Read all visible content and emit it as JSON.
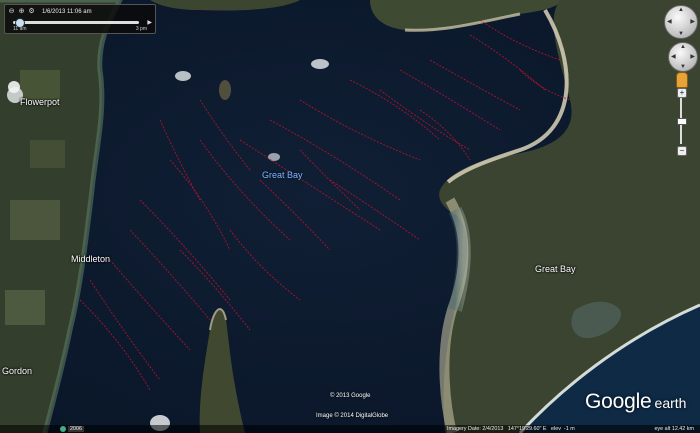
{
  "time_slider": {
    "date_text": "1/6/2013 11:06 am",
    "start_text": "11 am",
    "end_text": "3 pm"
  },
  "places": {
    "flowerpot": "Flowerpot",
    "middleton": "Middleton",
    "gordon": "Gordon",
    "great_bay_town": "Great Bay",
    "great_bay_water": "Great Bay"
  },
  "copyright": {
    "google": "© 2013 Google",
    "image": "Image © 2014 DigitalGlobe"
  },
  "logo": {
    "google": "Google",
    "earth": "earth"
  },
  "status": {
    "year": "2006",
    "date": "Imagery Date: 2/4/2013",
    "coords": "147°19'29.60\" E",
    "elev_label": "elev",
    "elev_value": "-1 m",
    "eye_alt": "eye alt 12.42 km"
  },
  "controls": {
    "zoom_in": "+",
    "zoom_out": "−"
  },
  "colors": {
    "track": "#c8102e",
    "water": "#0e1c30",
    "land": "#3b4430",
    "sand": "#d9d2b8"
  }
}
